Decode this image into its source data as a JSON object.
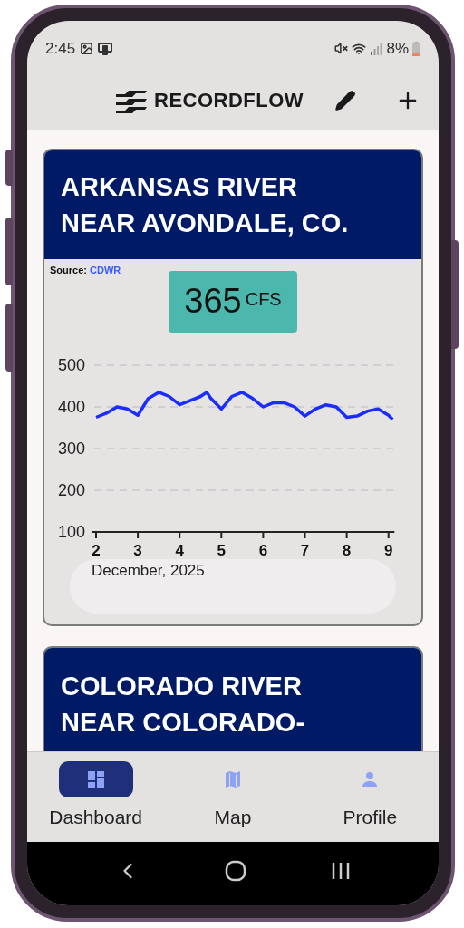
{
  "status_bar": {
    "time": "2:45",
    "battery": "8%"
  },
  "header": {
    "brand": "RECORDFLOW"
  },
  "cards": [
    {
      "title": "ARKANSAS RIVER NEAR AVONDALE, CO.",
      "source_label": "Source:",
      "source_link": "CDWR",
      "reading": "365",
      "unit": "CFS",
      "chart_data": {
        "type": "line",
        "xlabel": "December, 2025",
        "x": [
          2,
          2.25,
          2.5,
          2.75,
          3,
          3.25,
          3.5,
          3.75,
          4,
          4.25,
          4.5,
          4.65,
          4.75,
          5,
          5.25,
          5.5,
          5.75,
          6,
          6.25,
          6.5,
          6.75,
          7,
          7.25,
          7.5,
          7.75,
          8,
          8.25,
          8.5,
          8.75,
          9,
          9.1
        ],
        "series": [
          {
            "color": "#1a2cff",
            "values": [
              375,
              385,
              400,
              395,
              380,
              420,
              435,
              425,
              405,
              415,
              425,
              435,
              420,
              395,
              425,
              435,
              420,
              400,
              410,
              410,
              400,
              378,
              395,
              405,
              400,
              375,
              378,
              390,
              395,
              380,
              370
            ]
          }
        ],
        "grid": true,
        "xlim": [
          2,
          9.1
        ],
        "ylim": [
          100,
          500
        ],
        "xticks": [
          2,
          3,
          4,
          5,
          6,
          7,
          8,
          9
        ],
        "yticks": [
          100,
          200,
          300,
          400,
          500
        ]
      }
    },
    {
      "title": "COLORADO RIVER NEAR COLORADO-"
    }
  ],
  "bottom_nav": [
    {
      "label": "Dashboard",
      "kind": "dashboard",
      "selected": true
    },
    {
      "label": "Map",
      "kind": "map",
      "selected": false
    },
    {
      "label": "Profile",
      "kind": "person",
      "selected": false
    }
  ]
}
